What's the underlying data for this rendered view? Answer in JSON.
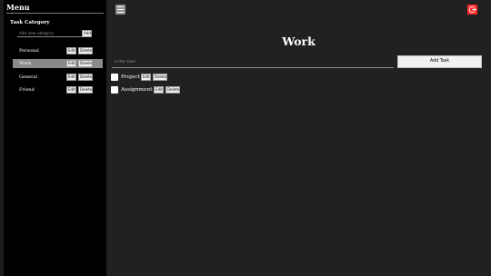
{
  "sidebar": {
    "title": "Menu",
    "section_heading": "Task Category",
    "new_category_placeholder": "Add new category",
    "add_label": "Add",
    "categories": [
      {
        "label": "Personal",
        "edit_label": "Edit",
        "delete_label": "Delete",
        "active": false
      },
      {
        "label": "Work",
        "edit_label": "Edit",
        "delete_label": "Delete",
        "active": true
      },
      {
        "label": "General",
        "edit_label": "Edit",
        "delete_label": "Delete",
        "active": false
      },
      {
        "label": "Friend",
        "edit_label": "Edit",
        "delete_label": "Delete",
        "active": false
      }
    ]
  },
  "header": {
    "menu_icon": "hamburger-icon",
    "logout_icon": "logout-icon",
    "logout_color": "#ff2a2a"
  },
  "main": {
    "title": "Work",
    "task_placeholder": "Enter task",
    "add_task_label": "Add Task",
    "tasks": [
      {
        "label": "Project",
        "edit_label": "Edit",
        "delete_label": "Delete",
        "checked": false
      },
      {
        "label": "Assignment",
        "edit_label": "Edit",
        "delete_label": "Delete",
        "checked": false
      }
    ]
  },
  "colors": {
    "sidebar_bg": "#000000",
    "main_bg": "#212123",
    "active_item_bg": "#8a8a8a"
  }
}
